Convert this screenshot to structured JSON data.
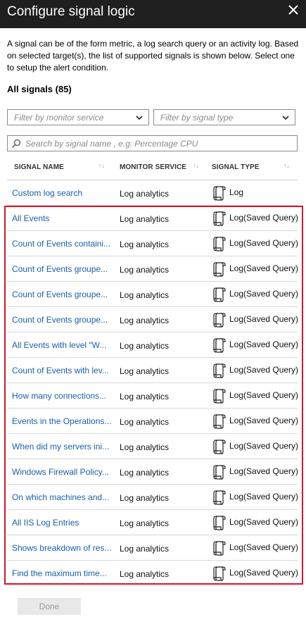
{
  "header": {
    "title": "Configure signal logic"
  },
  "description": "A signal can be of the form metric, a log search query or an activity log. Based on selected target(s), the list of supported signals is shown below. Select one to setup the alert condition.",
  "all_signals_label": "All signals (85)",
  "filters": {
    "monitor_service_placeholder": "Filter by monitor service",
    "signal_type_placeholder": "Filter by signal type"
  },
  "search": {
    "placeholder": "Search by signal name , e.g: Percentage CPU"
  },
  "table": {
    "columns": [
      "SIGNAL NAME",
      "MONITOR SERVICE",
      "SIGNAL TYPE"
    ],
    "rows": [
      {
        "name": "Custom log search",
        "service": "Log analytics",
        "type": "Log"
      },
      {
        "name": "All Events",
        "service": "Log analytics",
        "type": "Log(Saved Query)"
      },
      {
        "name": "Count of Events containi...",
        "service": "Log analytics",
        "type": "Log(Saved Query)"
      },
      {
        "name": "Count of Events groupe...",
        "service": "Log analytics",
        "type": "Log(Saved Query)"
      },
      {
        "name": "Count of Events groupe...",
        "service": "Log analytics",
        "type": "Log(Saved Query)"
      },
      {
        "name": "Count of Events groupe...",
        "service": "Log analytics",
        "type": "Log(Saved Query)"
      },
      {
        "name": "All Events with level \"W...",
        "service": "Log analytics",
        "type": "Log(Saved Query)"
      },
      {
        "name": "Count of Events with lev...",
        "service": "Log analytics",
        "type": "Log(Saved Query)"
      },
      {
        "name": "How many connections...",
        "service": "Log analytics",
        "type": "Log(Saved Query)"
      },
      {
        "name": "Events in the Operations...",
        "service": "Log analytics",
        "type": "Log(Saved Query)"
      },
      {
        "name": "When did my servers ini...",
        "service": "Log analytics",
        "type": "Log(Saved Query)"
      },
      {
        "name": "Windows Firewall Policy...",
        "service": "Log analytics",
        "type": "Log(Saved Query)"
      },
      {
        "name": "On which machines and...",
        "service": "Log analytics",
        "type": "Log(Saved Query)"
      },
      {
        "name": "All IIS Log Entries",
        "service": "Log analytics",
        "type": "Log(Saved Query)"
      },
      {
        "name": "Shows breakdown of res...",
        "service": "Log analytics",
        "type": "Log(Saved Query)"
      },
      {
        "name": "Find the maximum time...",
        "service": "Log analytics",
        "type": "Log(Saved Query)"
      }
    ]
  },
  "footer": {
    "done_label": "Done"
  },
  "colors": {
    "link": "#1a5ea8",
    "highlight": "#d0162e",
    "header_bg": "#1f1f1f"
  }
}
